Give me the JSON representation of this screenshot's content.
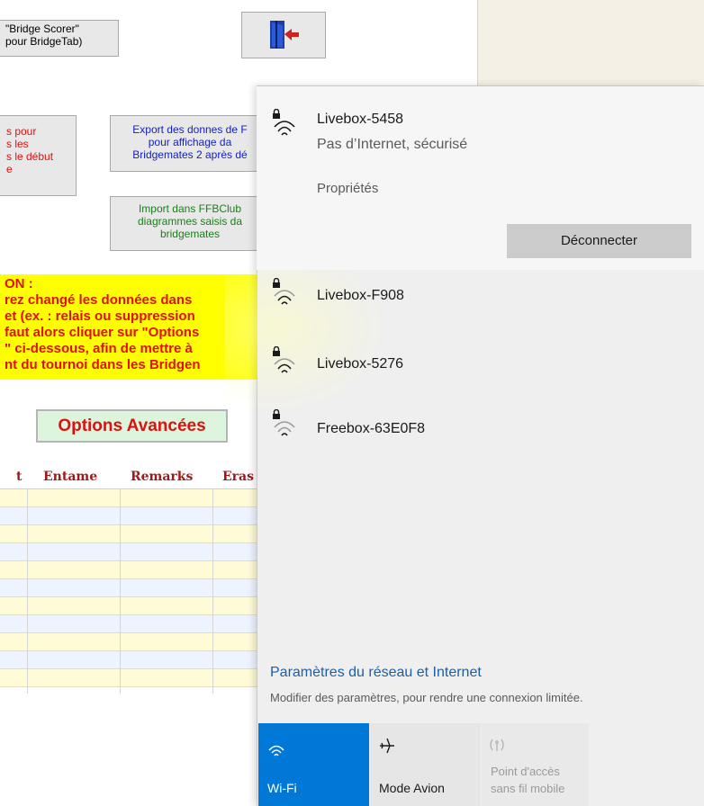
{
  "background_app": {
    "bridge_scorer_button": {
      "line1": "\"Bridge Scorer\"",
      "line2": "pour BridgeTab)"
    },
    "red_button_lines": [
      "s pour",
      "s les",
      "s le début",
      "e"
    ],
    "export_button_lines": [
      "Export des donnes de F",
      "pour affichage da",
      "Bridgemates 2 après dé"
    ],
    "import_button_lines": [
      "Import dans FFBClub",
      "diagrammes saisis da",
      "bridgemates"
    ],
    "warning_text": "ON :\nrez changé les données dans\net (ex. : relais ou suppression\nfaut alors cliquer sur \"Options\n\" ci-dessous, afin de mettre à\nnt du tournoi dans les Bridgen",
    "options_button": "Options Avancées",
    "table_headers": [
      "t",
      "Entame",
      "Remarks",
      "Eras"
    ]
  },
  "wifi_flyout": {
    "connected_network": {
      "name": "Livebox-5458",
      "status": "Pas d’Internet, sécurisé",
      "properties_link": "Propriétés",
      "disconnect_button": "Déconnecter"
    },
    "networks": [
      {
        "name": "Livebox-F908",
        "icon": "wifi-secured-icon"
      },
      {
        "name": "Livebox-5276",
        "icon": "wifi-secured-icon"
      },
      {
        "name": "Freebox-63E0F8",
        "icon": "wifi-secured-icon"
      }
    ],
    "settings_link": "Paramètres du réseau et Internet",
    "settings_sub": "Modifier des paramètres, pour rendre une connexion limitée.",
    "quick_actions": {
      "wifi": {
        "label": "Wi-Fi",
        "active": true
      },
      "airplane": {
        "label": "Mode Avion"
      },
      "hotspot": {
        "line1": "Point d'accès",
        "line2": "sans fil mobile",
        "disabled": true
      }
    }
  },
  "colors": {
    "accent": "#0078d7",
    "link": "#1b5fa8",
    "warning_bg": "#ffff00",
    "warning_text": "#e01010"
  }
}
